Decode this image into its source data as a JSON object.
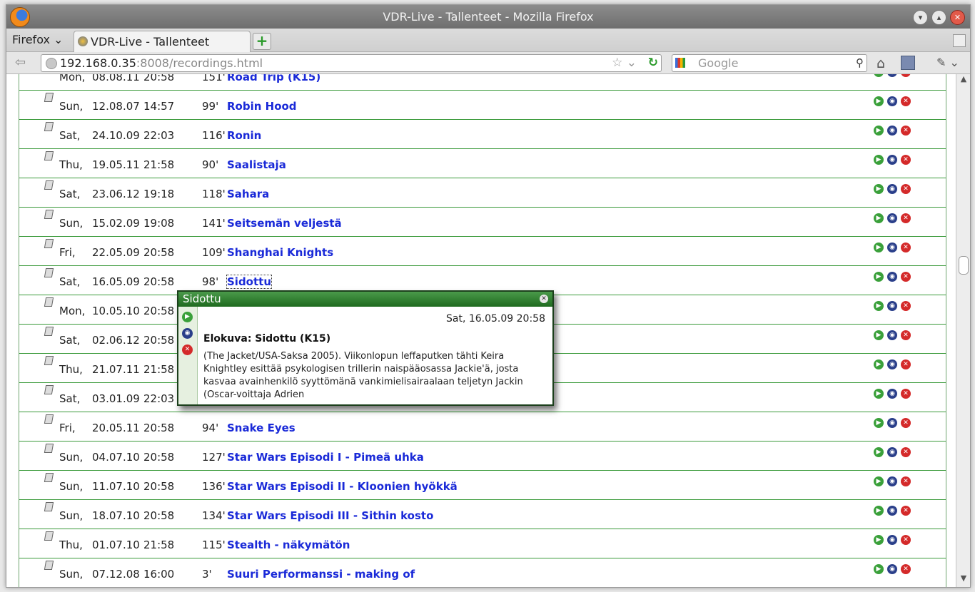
{
  "window": {
    "title": "VDR-Live - Tallenteet - Mozilla Firefox"
  },
  "tabbar": {
    "menu_label": "Firefox",
    "tab_label": "VDR-Live - Tallenteet",
    "new_tab": "+"
  },
  "navbar": {
    "url_host": "192.168.0.35",
    "url_rest": ":8008/recordings.html",
    "search_placeholder": "Google"
  },
  "recordings": [
    {
      "day": "Mon,",
      "date": "08.08.11",
      "time": "20:58",
      "len": "151'",
      "title": "Road Trip (K15)"
    },
    {
      "day": "Sun,",
      "date": "12.08.07",
      "time": "14:57",
      "len": "99'",
      "title": "Robin Hood"
    },
    {
      "day": "Sat,",
      "date": "24.10.09",
      "time": "22:03",
      "len": "116'",
      "title": "Ronin"
    },
    {
      "day": "Thu,",
      "date": "19.05.11",
      "time": "21:58",
      "len": "90'",
      "title": "Saalistaja"
    },
    {
      "day": "Sat,",
      "date": "23.06.12",
      "time": "19:18",
      "len": "118'",
      "title": "Sahara"
    },
    {
      "day": "Sun,",
      "date": "15.02.09",
      "time": "19:08",
      "len": "141'",
      "title": "Seitsemän veljestä"
    },
    {
      "day": "Fri,",
      "date": "22.05.09",
      "time": "20:58",
      "len": "109'",
      "title": "Shanghai Knights"
    },
    {
      "day": "Sat,",
      "date": "16.05.09",
      "time": "20:58",
      "len": "98'",
      "title": "Sidottu"
    },
    {
      "day": "Mon,",
      "date": "10.05.10",
      "time": "20:58",
      "len": "",
      "title": ""
    },
    {
      "day": "Sat,",
      "date": "02.06.12",
      "time": "20:58",
      "len": "",
      "title": ""
    },
    {
      "day": "Thu,",
      "date": "21.07.11",
      "time": "21:58",
      "len": "",
      "title": ""
    },
    {
      "day": "Sat,",
      "date": "03.01.09",
      "time": "22:03",
      "len": "",
      "title": ""
    },
    {
      "day": "Fri,",
      "date": "20.05.11",
      "time": "20:58",
      "len": "94'",
      "title": "Snake Eyes"
    },
    {
      "day": "Sun,",
      "date": "04.07.10",
      "time": "20:58",
      "len": "127'",
      "title": "Star Wars Episodi I - Pimeä uhka"
    },
    {
      "day": "Sun,",
      "date": "11.07.10",
      "time": "20:58",
      "len": "136'",
      "title": "Star Wars Episodi II - Kloonien hyökkä"
    },
    {
      "day": "Sun,",
      "date": "18.07.10",
      "time": "20:58",
      "len": "134'",
      "title": "Star Wars Episodi III - Sithin kosto"
    },
    {
      "day": "Thu,",
      "date": "01.07.10",
      "time": "21:58",
      "len": "115'",
      "title": "Stealth - näkymätön"
    },
    {
      "day": "Sun,",
      "date": "07.12.08",
      "time": "16:00",
      "len": "3'",
      "title": "Suuri Performanssi - making of"
    }
  ],
  "popup": {
    "title": "Sidottu",
    "datetime": "Sat, 16.05.09 20:58",
    "subtitle": "Elokuva: Sidottu (K15)",
    "description": "(The Jacket/USA-Saksa 2005). Viikonlopun leffaputken tähti Keira Knightley esittää psykologisen trillerin naispääosassa Jackie'ä, josta kasvaa avainhenkilö syyttömänä vankimielisairaalaan teljetyn Jackin (Oscar-voittaja Adrien"
  },
  "icons": {
    "play": "play-icon",
    "stream": "stream-icon",
    "delete": "delete-icon",
    "recording": "recording-icon"
  },
  "colors": {
    "link": "#1a2ad8",
    "row_border": "#3a9a3a",
    "popup_header": "#1f6a1f"
  }
}
